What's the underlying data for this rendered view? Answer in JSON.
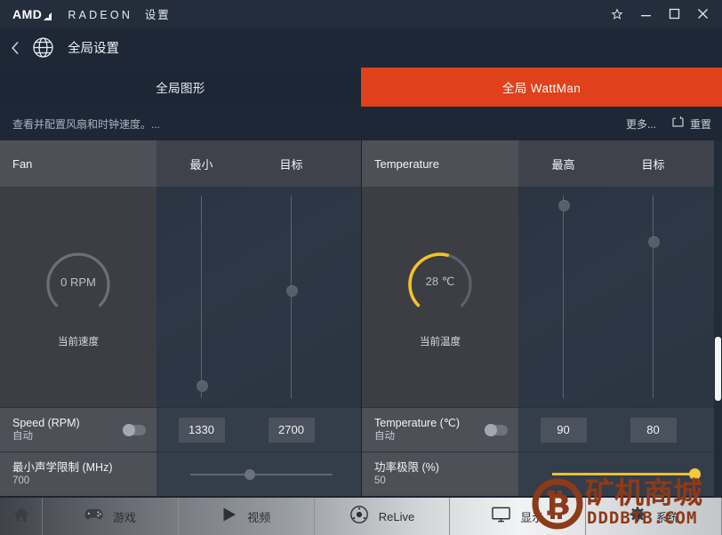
{
  "window": {
    "logo_text": "AMD",
    "brand": "RADEON",
    "brand_suffix": "设置",
    "controls": [
      {
        "name": "favorite-button",
        "glyph": "star-icon"
      },
      {
        "name": "minimize-button",
        "glyph": "minimize-icon"
      },
      {
        "name": "maximize-button",
        "glyph": "maximize-icon"
      },
      {
        "name": "close-button",
        "glyph": "close-icon"
      }
    ]
  },
  "subheader": {
    "back_label": "‹",
    "icon": "globe-icon",
    "title": "全局设置"
  },
  "tabs": [
    {
      "label": "全局图形",
      "active": false
    },
    {
      "label": "全局 WattMan",
      "active": true
    }
  ],
  "descbar": {
    "text": "查看并配置风扇和时钟速度。...",
    "more_label": "更多...",
    "reset_label": "重置",
    "reset_icon": "reset-square-icon"
  },
  "panels": [
    {
      "id": "fan",
      "header": {
        "label": "Fan",
        "columns": [
          "最小",
          "目标"
        ]
      },
      "gauge": {
        "value": "0 RPM",
        "caption": "当前速度",
        "percent": 0,
        "color": "#6b7078",
        "track_color": "#6b7078"
      },
      "sliders": [
        {
          "name": "fan-min-slider",
          "thumb_pct": 94
        },
        {
          "name": "fan-target-slider",
          "thumb_pct": 47
        }
      ],
      "rows": [
        {
          "kind": "numbers",
          "label": "Speed (RPM)",
          "sublabel": "自动",
          "toggle": {
            "name": "fan-speed-auto-toggle",
            "on": false
          },
          "values": [
            "1330",
            "2700"
          ]
        },
        {
          "kind": "slider",
          "label": "最小声学限制 (MHz)",
          "sublabel": "700",
          "slider": {
            "name": "min-acoustic-limit-slider",
            "thumb_pct": 42,
            "accent": false
          }
        }
      ]
    },
    {
      "id": "temperature",
      "header": {
        "label": "Temperature",
        "columns": [
          "最高",
          "目标"
        ]
      },
      "gauge": {
        "value": "28 ℃",
        "caption": "当前温度",
        "percent": 56,
        "color": "#f5c324",
        "track_color": "#5d6168"
      },
      "sliders": [
        {
          "name": "temp-max-slider",
          "thumb_pct": 5
        },
        {
          "name": "temp-target-slider",
          "thumb_pct": 23
        }
      ],
      "rows": [
        {
          "kind": "numbers",
          "label": "Temperature (℃)",
          "sublabel": "自动",
          "toggle": {
            "name": "temperature-auto-toggle",
            "on": false
          },
          "values": [
            "90",
            "80"
          ]
        },
        {
          "kind": "slider",
          "label": "功率极限 (%)",
          "sublabel": "50",
          "slider": {
            "name": "power-limit-slider",
            "thumb_pct": 100,
            "accent": true
          }
        }
      ]
    }
  ],
  "scrollbar": {
    "thumb_top_pct": 55,
    "thumb_height_pct": 18
  },
  "bottom_nav": [
    {
      "label": "",
      "icon": "home-icon",
      "name": "nav-home"
    },
    {
      "label": "游戏",
      "icon": "gamepad-icon",
      "name": "nav-gaming"
    },
    {
      "label": "视频",
      "icon": "play-icon",
      "name": "nav-video"
    },
    {
      "label": "ReLive",
      "icon": "relive-atom-icon",
      "name": "nav-relive"
    },
    {
      "label": "显示",
      "icon": "monitor-icon",
      "name": "nav-display"
    },
    {
      "label": "系统",
      "icon": "gear-icon",
      "name": "nav-system"
    }
  ],
  "watermark": {
    "cn_text": "矿机商城",
    "url_text": "DDDBTB.COM",
    "color": "#8d3a18"
  },
  "colors": {
    "accent_tab": "#e0401a",
    "gauge_amber": "#f5c324",
    "titlebar": "#232d3b",
    "panel_label": "#4e5057"
  }
}
